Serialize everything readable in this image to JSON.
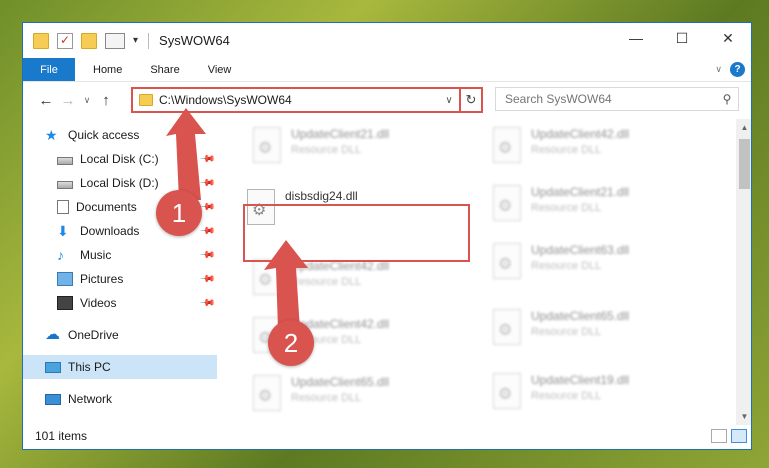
{
  "window": {
    "title": "SysWOW64",
    "controls": [
      "minimize-icon",
      "maximize-icon",
      "close-icon"
    ]
  },
  "ribbon": {
    "file": "File",
    "tabs": [
      "Home",
      "Share",
      "View"
    ]
  },
  "nav": {
    "address": "C:\\Windows\\SysWOW64",
    "search_placeholder": "Search SysWOW64"
  },
  "sidebar": {
    "items": [
      {
        "label": "Quick access",
        "icon": "star-icon"
      },
      {
        "label": "Local Disk (C:)",
        "icon": "drive-icon",
        "pinned": true
      },
      {
        "label": "Local Disk (D:)",
        "icon": "drive-icon",
        "pinned": true
      },
      {
        "label": "Documents",
        "icon": "documents-icon",
        "pinned": true
      },
      {
        "label": "Downloads",
        "icon": "downloads-icon",
        "pinned": true
      },
      {
        "label": "Music",
        "icon": "music-icon",
        "pinned": true
      },
      {
        "label": "Pictures",
        "icon": "pictures-icon",
        "pinned": true
      },
      {
        "label": "Videos",
        "icon": "videos-icon",
        "pinned": true
      },
      {
        "label": "OneDrive",
        "icon": "onedrive-icon"
      },
      {
        "label": "This PC",
        "icon": "this-pc-icon",
        "selected": true
      },
      {
        "label": "Network",
        "icon": "network-icon"
      }
    ]
  },
  "files": {
    "highlighted": {
      "name": "disbsdig24.dll"
    },
    "left_column": [
      {
        "name": "UpdateClient21.dll",
        "type": "Resource DLL"
      },
      {
        "name": "UpdateClient42.dll",
        "type": "Resource DLL"
      },
      {
        "name": "UpdateClient42.dll",
        "type": "Resource DLL"
      },
      {
        "name": "UpdateClient65.dll",
        "type": "Resource DLL"
      }
    ],
    "right_column": [
      {
        "name": "UpdateClient42.dll",
        "type": "Resource DLL"
      },
      {
        "name": "UpdateClient21.dll",
        "type": "Resource DLL"
      },
      {
        "name": "UpdateClient63.dll",
        "type": "Resource DLL"
      },
      {
        "name": "UpdateClient65.dll",
        "type": "Resource DLL"
      },
      {
        "name": "UpdateClient19.dll",
        "type": "Resource DLL"
      }
    ]
  },
  "status": {
    "item_count": "101 items"
  },
  "annotations": {
    "step1": "1",
    "step2": "2",
    "color": "#d9534f"
  }
}
